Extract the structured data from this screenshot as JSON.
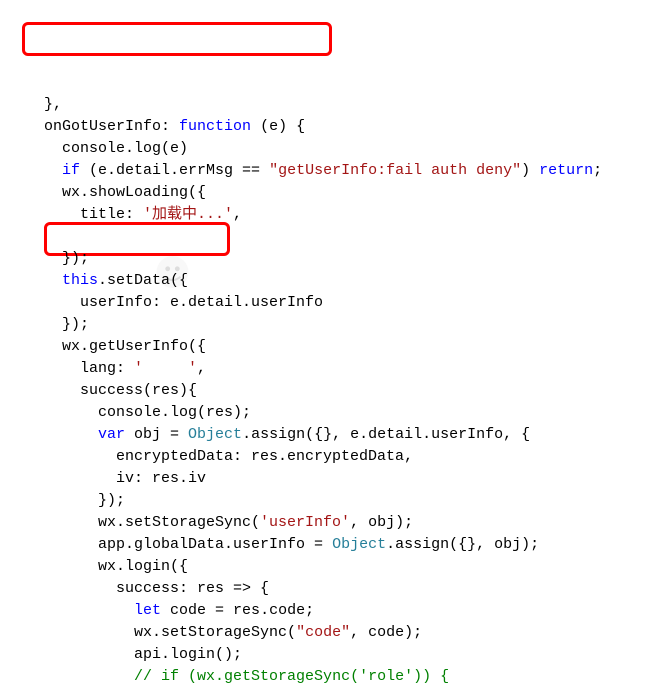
{
  "lines": [
    {
      "indent": 1,
      "tokens": [
        {
          "t": "},",
          "c": "txt"
        }
      ]
    },
    {
      "indent": 1,
      "tokens": [
        {
          "t": "onGotUserInfo: ",
          "c": "txt"
        },
        {
          "t": "function",
          "c": "kw"
        },
        {
          "t": " (e) {",
          "c": "txt"
        }
      ]
    },
    {
      "indent": 2,
      "tokens": [
        {
          "t": "console.log(e)",
          "c": "txt"
        }
      ]
    },
    {
      "indent": 2,
      "tokens": [
        {
          "t": "if",
          "c": "kw"
        },
        {
          "t": " (e.detail.errMsg == ",
          "c": "txt"
        },
        {
          "t": "\"getUserInfo:fail auth deny\"",
          "c": "str"
        },
        {
          "t": ") ",
          "c": "txt"
        },
        {
          "t": "return",
          "c": "kw"
        },
        {
          "t": ";",
          "c": "txt"
        }
      ]
    },
    {
      "indent": 2,
      "tokens": [
        {
          "t": "wx.showLoading({",
          "c": "txt"
        }
      ]
    },
    {
      "indent": 3,
      "tokens": [
        {
          "t": "title: ",
          "c": "txt"
        },
        {
          "t": "'加载中...'",
          "c": "str"
        },
        {
          "t": ",",
          "c": "txt"
        }
      ]
    },
    {
      "indent": 0,
      "tokens": [
        {
          "t": "",
          "c": "txt"
        }
      ]
    },
    {
      "indent": 2,
      "tokens": [
        {
          "t": "});",
          "c": "txt"
        }
      ]
    },
    {
      "indent": 2,
      "tokens": [
        {
          "t": "this",
          "c": "kw"
        },
        {
          "t": ".setData({",
          "c": "txt"
        }
      ]
    },
    {
      "indent": 3,
      "tokens": [
        {
          "t": "userInfo: e.detail.userInfo",
          "c": "txt"
        }
      ]
    },
    {
      "indent": 2,
      "tokens": [
        {
          "t": "});",
          "c": "txt"
        }
      ]
    },
    {
      "indent": 2,
      "tokens": [
        {
          "t": "wx.getUserInfo({",
          "c": "txt"
        }
      ]
    },
    {
      "indent": 3,
      "tokens": [
        {
          "t": "lang: ",
          "c": "txt"
        },
        {
          "t": "'     '",
          "c": "str"
        },
        {
          "t": ",",
          "c": "txt"
        }
      ]
    },
    {
      "indent": 3,
      "tokens": [
        {
          "t": "success(res){",
          "c": "txt"
        }
      ]
    },
    {
      "indent": 4,
      "tokens": [
        {
          "t": "console.log(res);",
          "c": "txt"
        }
      ]
    },
    {
      "indent": 4,
      "tokens": [
        {
          "t": "var",
          "c": "kw"
        },
        {
          "t": " obj = ",
          "c": "txt"
        },
        {
          "t": "Object",
          "c": "type"
        },
        {
          "t": ".assign({}, e.detail.userInfo, {",
          "c": "txt"
        }
      ]
    },
    {
      "indent": 5,
      "tokens": [
        {
          "t": "encryptedData: res.encryptedData,",
          "c": "txt"
        }
      ]
    },
    {
      "indent": 5,
      "tokens": [
        {
          "t": "iv: res.iv",
          "c": "txt"
        }
      ]
    },
    {
      "indent": 4,
      "tokens": [
        {
          "t": "});",
          "c": "txt"
        }
      ]
    },
    {
      "indent": 4,
      "tokens": [
        {
          "t": "wx.setStorageSync(",
          "c": "txt"
        },
        {
          "t": "'userInfo'",
          "c": "str"
        },
        {
          "t": ", obj);",
          "c": "txt"
        }
      ]
    },
    {
      "indent": 4,
      "tokens": [
        {
          "t": "app.globalData.userInfo = ",
          "c": "txt"
        },
        {
          "t": "Object",
          "c": "type"
        },
        {
          "t": ".assign({}, obj);",
          "c": "txt"
        }
      ]
    },
    {
      "indent": 4,
      "tokens": [
        {
          "t": "wx.login({",
          "c": "txt"
        }
      ]
    },
    {
      "indent": 5,
      "tokens": [
        {
          "t": "success: res => {",
          "c": "txt"
        }
      ]
    },
    {
      "indent": 6,
      "tokens": [
        {
          "t": "let",
          "c": "kw"
        },
        {
          "t": " code = res.code;",
          "c": "txt"
        }
      ]
    },
    {
      "indent": 6,
      "tokens": [
        {
          "t": "wx.setStorageSync(",
          "c": "txt"
        },
        {
          "t": "\"code\"",
          "c": "str"
        },
        {
          "t": ", code);",
          "c": "txt"
        }
      ]
    },
    {
      "indent": 6,
      "tokens": [
        {
          "t": "api.login();",
          "c": "txt"
        }
      ]
    },
    {
      "indent": 6,
      "tokens": [
        {
          "t": "// if (wx.getStorageSync('role')) {",
          "c": "comment"
        }
      ]
    }
  ],
  "indent_unit": "  "
}
